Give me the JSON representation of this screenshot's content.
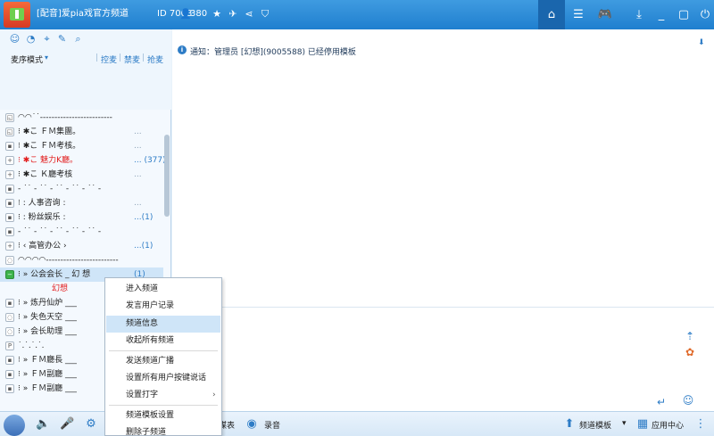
{
  "titlebar": {
    "title": "[配音]爱pia戏官方频道",
    "id": "ID 7068",
    "online": "380"
  },
  "sidebar": {
    "sort_mode": "麦序模式",
    "links": [
      "控麦",
      "禁麦",
      "抢麦"
    ]
  },
  "tree": [
    {
      "icon": "◱",
      "label": "◠◠˙˙-------------------------",
      "count": "",
      "color": "#222",
      "indent": 20
    },
    {
      "icon": "◱",
      "label": "⁝        ✱こ ＦＭ集團。",
      "count": "...",
      "color": "#222",
      "indent": 20
    },
    {
      "icon": "▪",
      "label": "⁝        ✱こ ＦＭ考核。",
      "count": "...",
      "color": "#222",
      "indent": 20
    },
    {
      "icon": "+",
      "label": "⁝        ✱こ 魅力K廳。",
      "count": "... (377)",
      "color": "#e21b1b",
      "indent": 20
    },
    {
      "icon": "+",
      "label": "⁝        ✱こ Ｋ廳考核",
      "count": "...",
      "color": "#222",
      "indent": 20
    },
    {
      "icon": "▪",
      "label": "-  ˙˙ -  ˙˙ -  ˙˙ -  ˙˙ -  ˙˙ -",
      "count": "",
      "color": "#222",
      "indent": 20
    },
    {
      "icon": "▪",
      "label": "⁝           :  人事咨询  :",
      "count": "...",
      "color": "#222",
      "indent": 20
    },
    {
      "icon": "▪",
      "label": "⁝           :  粉丝娱乐  :",
      "count": "...(1)",
      "color": "#222",
      "indent": 20
    },
    {
      "icon": "▪",
      "label": "-  ˙˙ -  ˙˙ -  ˙˙ -  ˙˙ -  ˙˙ -",
      "count": "",
      "color": "#222",
      "indent": 20
    },
    {
      "icon": "+",
      "label": "⁝             ‹  高管办公  ›",
      "count": "...(1)",
      "color": "#222",
      "indent": 20
    },
    {
      "icon": "◌",
      "label": "◠◠◠◠-------------------------",
      "count": "",
      "color": "#222",
      "indent": 20
    },
    {
      "icon": "−",
      "label": "⁝   »  公会会长 _  幻   想",
      "count": "(1)",
      "color": "#222",
      "indent": 20
    },
    {
      "icon": "",
      "label": "幻想",
      "count": "",
      "color": "#e21b1b",
      "indent": 58
    },
    {
      "icon": "▪",
      "label": "⁝   »  炼丹仙炉 ___",
      "count": "",
      "color": "#222",
      "indent": 20
    },
    {
      "icon": "◌",
      "label": "⁝   »  失色天空 ___",
      "count": "",
      "color": "#222",
      "indent": 20
    },
    {
      "icon": "◌",
      "label": "⁝   »  会长助理 ___",
      "count": "",
      "color": "#222",
      "indent": 20
    },
    {
      "icon": "P",
      "label": "              ˙.˙.˙.˙.",
      "count": "",
      "color": "#222",
      "indent": 20
    },
    {
      "icon": "▪",
      "label": "⁝   »  ＦＭ廳長 ___",
      "count": "",
      "color": "#222",
      "indent": 20
    },
    {
      "icon": "▪",
      "label": "⁝   »  ＦＭ副廳 ___",
      "count": "",
      "color": "#222",
      "indent": 20
    },
    {
      "icon": "▪",
      "label": "⁝   »  ＦＭ副廳 ___",
      "count": "",
      "color": "#222",
      "indent": 20
    }
  ],
  "notice": {
    "text": "通知：管理员 [幻想](9005588) 已经停用模板"
  },
  "context_menu": {
    "items": [
      "进入频道",
      "发言用户记录",
      "频道信息",
      "收起所有频道",
      "发送频道广播",
      "设置所有用户按键说话",
      "设置打字",
      "频道模板设置",
      "删除子频道"
    ]
  },
  "bottom": {
    "recording": "录音",
    "voice_label": "谋表",
    "template": "频道模板",
    "app_center": "应用中心"
  },
  "colors": {
    "titlebar": "#2a8ad8",
    "selected": "#cfe5f8",
    "accent": "#2d7cc6"
  }
}
